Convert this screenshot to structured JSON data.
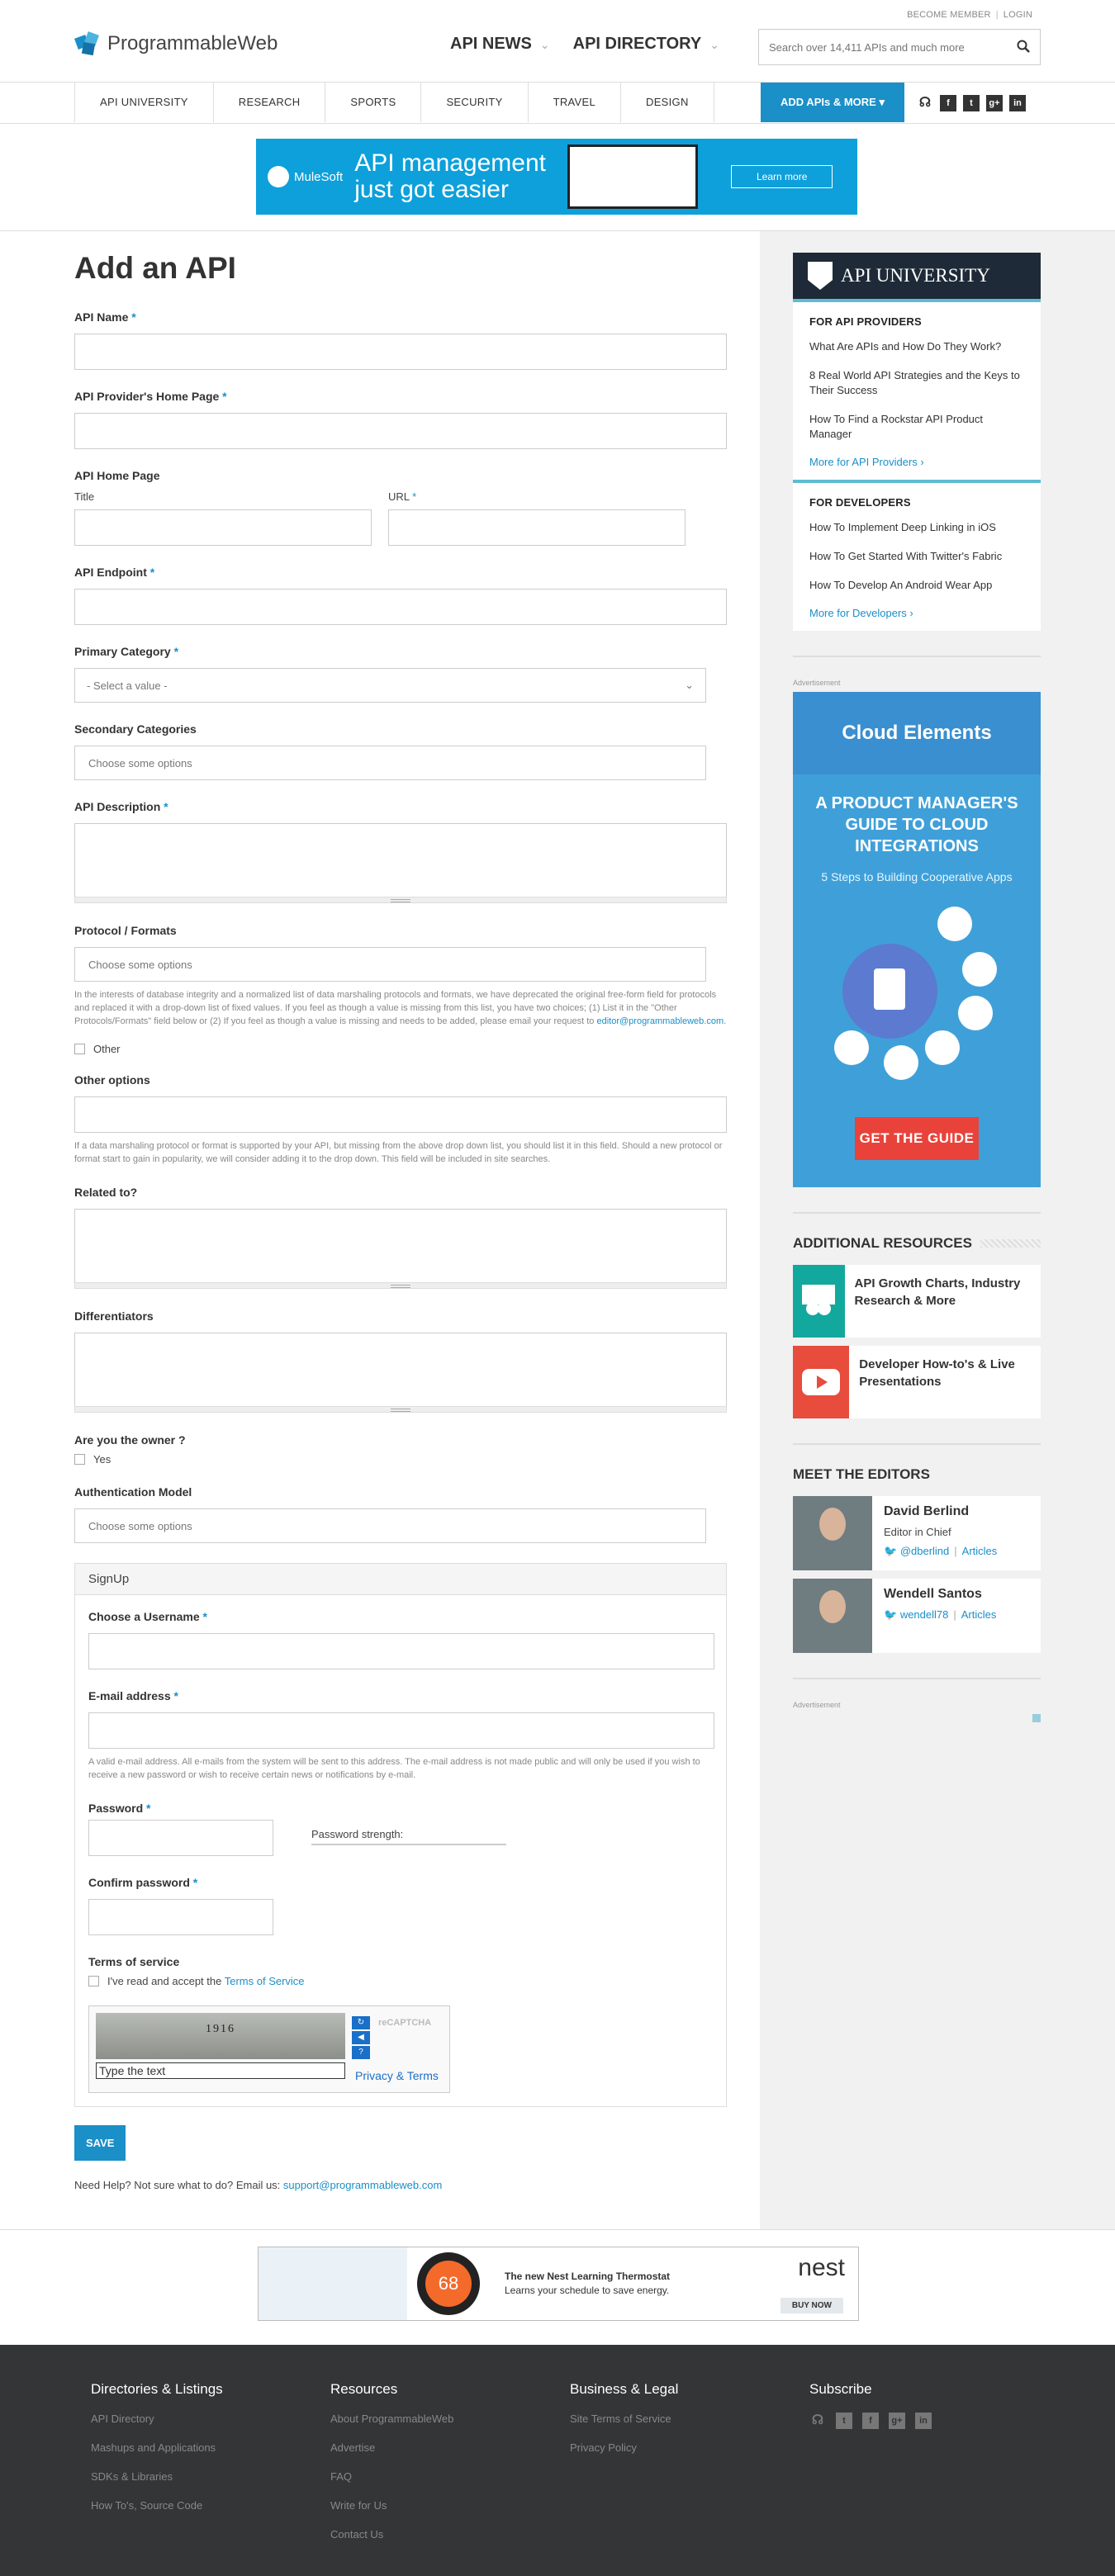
{
  "header": {
    "member_links": [
      "BECOME MEMBER",
      "LOGIN"
    ],
    "logo_text": "ProgrammableWeb",
    "nav": [
      "API NEWS",
      "API DIRECTORY"
    ],
    "search_placeholder": "Search over 14,411 APIs and much more"
  },
  "subnav": {
    "items": [
      "API UNIVERSITY",
      "RESEARCH",
      "SPORTS",
      "SECURITY",
      "TRAVEL",
      "DESIGN"
    ],
    "add_button": "ADD APIs & MORE",
    "social": [
      "rss-icon",
      "facebook-icon",
      "twitter-icon",
      "google-plus-icon",
      "linkedin-icon"
    ]
  },
  "top_ad": {
    "brand": "MuleSoft",
    "headline_1": "API management",
    "headline_2": "just got easier",
    "button": "Learn more"
  },
  "form": {
    "title": "Add an API",
    "api_name": "API Name",
    "provider_home": "API Provider's Home Page",
    "api_home": "API Home Page",
    "title_label": "Title",
    "url_label": "URL",
    "endpoint": "API Endpoint",
    "primary_category": "Primary Category",
    "primary_value": "- Select a value -",
    "secondary_categories": "Secondary Categories",
    "choose_options": "Choose some options",
    "description": "API Description",
    "protocol": "Protocol / Formats",
    "protocol_help_1": "In the interests of database integrity and a normalized list of data marshaling protocols and formats, we have deprecated the original free-form field for protocols and replaced it with a drop-down list of fixed values. If you feel as though a value is missing from this list, you have two choices; (1) List it in the \"Other Protocols/Formats\" field below or (2) If you feel as though a value is missing and needs to be added, please email your request to ",
    "protocol_help_email": "editor@programmableweb.com",
    "protocol_help_end": ".",
    "other_checkbox": "Other",
    "other_options": "Other options",
    "other_help": "If a data marshaling protocol or format is supported by your API, but missing from the above drop down list, you should list it in this field. Should a new protocol or format start to gain in popularity, we will consider adding it to the drop down. This field will be included in site searches.",
    "related": "Related to?",
    "differentiators": "Differentiators",
    "owner": "Are you the owner ?",
    "owner_yes": "Yes",
    "auth_model": "Authentication Model",
    "required_mark": "*"
  },
  "signup": {
    "heading": "SignUp",
    "username": "Choose a Username",
    "email": "E-mail address",
    "email_help": "A valid e-mail address. All e-mails from the system will be sent to this address. The e-mail address is not made public and will only be used if you wish to receive a new password or wish to receive certain news or notifications by e-mail.",
    "password": "Password",
    "strength": "Password strength:",
    "confirm": "Confirm password",
    "terms_heading": "Terms of service",
    "terms_text": "I've read and accept the ",
    "terms_link": "Terms of Service",
    "captcha_text": "1916",
    "captcha_placeholder": "Type the text",
    "captcha_logo": "reCAPTCHA",
    "captcha_terms": "Privacy & Terms"
  },
  "actions": {
    "save": "SAVE",
    "help_text": "Need Help? Not sure what to do? Email us: ",
    "help_email": "support@programmableweb.com"
  },
  "sidebar": {
    "university_title": "API UNIVERSITY",
    "providers_heading": "FOR API PROVIDERS",
    "providers_items": [
      "What Are APIs and How Do They Work?",
      "8 Real World API Strategies and the Keys to Their Success",
      "How To Find a Rockstar API Product Manager"
    ],
    "providers_more": "More for API Providers ›",
    "developers_heading": "FOR DEVELOPERS",
    "developers_items": [
      "How To Implement Deep Linking in iOS",
      "How To Get Started With Twitter's Fabric",
      "How To Develop An Android Wear App"
    ],
    "developers_more": "More for Developers ›",
    "ad_label": "Advertisement",
    "cloud_ad": {
      "brand": "Cloud Elements",
      "title": "A PRODUCT MANAGER'S GUIDE TO CLOUD INTEGRATIONS",
      "subtitle": "5 Steps to Building Cooperative Apps",
      "cta": "GET THE GUIDE"
    },
    "resources_heading": "ADDITIONAL RESOURCES",
    "resources": [
      "API Growth Charts, Industry Research & More",
      "Developer How-to's & Live Presentations"
    ],
    "editors_heading": "MEET THE EDITORS",
    "editors": [
      {
        "name": "David Berlind",
        "role": "Editor in Chief",
        "handle": "@dberlind",
        "articles": "Articles"
      },
      {
        "name": "Wendell Santos",
        "role": "",
        "handle": "wendell78",
        "articles": "Articles"
      }
    ],
    "ad_label_2": "Advertisement"
  },
  "bottom_ad": {
    "temp": "68",
    "line1": "The new Nest Learning Thermostat",
    "line2": "Learns your schedule to save energy.",
    "brand": "nest",
    "button": "BUY NOW"
  },
  "footer": {
    "cols": [
      {
        "heading": "Directories & Listings",
        "links": [
          "API Directory",
          "Mashups and Applications",
          "SDKs & Libraries",
          "How To's, Source Code"
        ]
      },
      {
        "heading": "Resources",
        "links": [
          "About ProgrammableWeb",
          "Advertise",
          "FAQ",
          "Write for Us",
          "Contact Us"
        ]
      },
      {
        "heading": "Business & Legal",
        "links": [
          "Site Terms of Service",
          "Privacy Policy"
        ]
      },
      {
        "heading": "Subscribe",
        "links": []
      }
    ]
  },
  "colors": {
    "accent": "#1a8fc8",
    "footer_bg": "#333536",
    "university_bar": "#1e2a38"
  }
}
